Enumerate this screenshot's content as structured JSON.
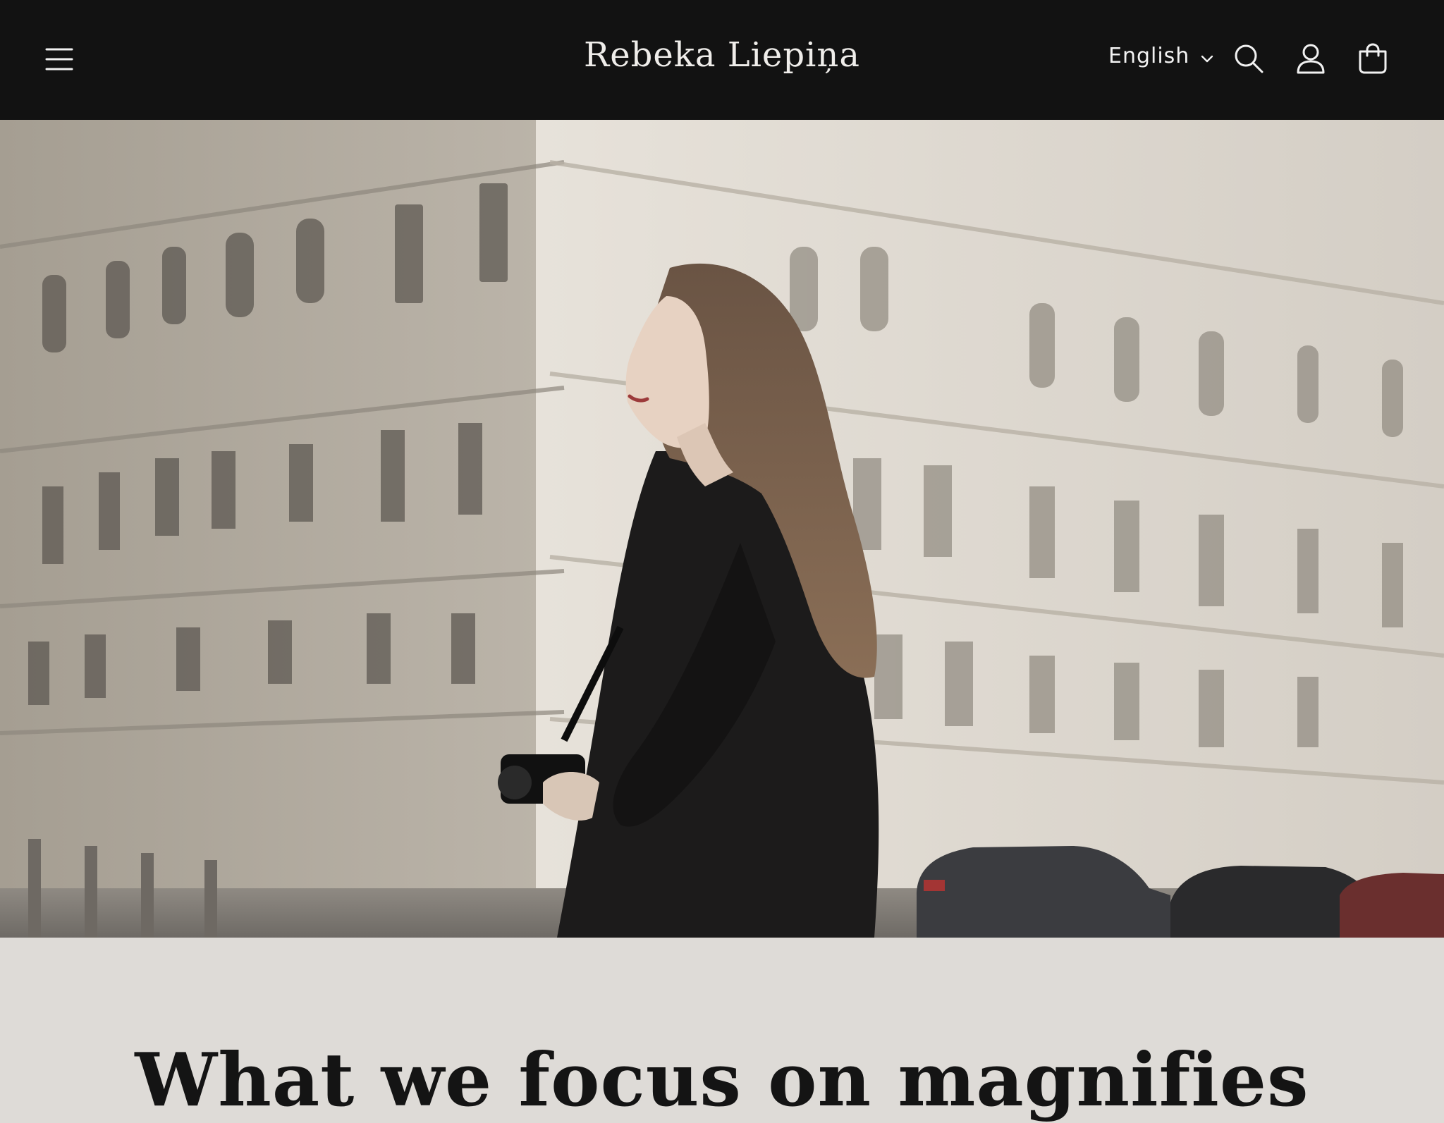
{
  "header": {
    "logo": "Rebeka Liepiņa",
    "language": "English",
    "icons": {
      "menu": "hamburger-menu-icon",
      "language_caret": "chevron-down-icon",
      "search": "search-icon",
      "account": "user-icon",
      "cart": "shopping-bag-icon"
    },
    "background_color": "#121212",
    "text_color": "#efedea"
  },
  "hero": {
    "image_description_hidden": ""
  },
  "section": {
    "headline": "What we focus on magnifies",
    "background_color": "#dedbd7"
  }
}
